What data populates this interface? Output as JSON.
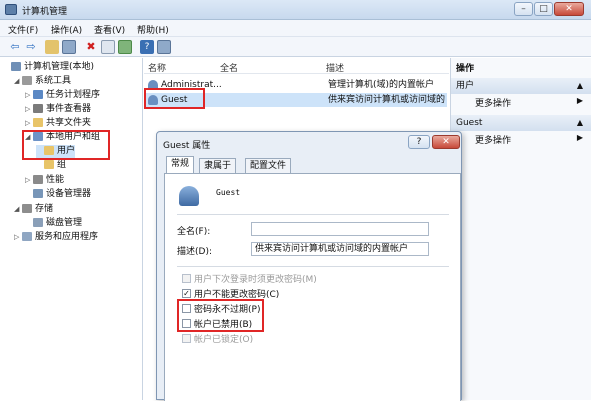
{
  "window": {
    "title": "计算机管理",
    "buttons": [
      "–",
      "□",
      "✕"
    ]
  },
  "menu": [
    "文件(F)",
    "操作(A)",
    "查看(V)",
    "帮助(H)"
  ],
  "tree": [
    {
      "label": "计算机管理(本地)",
      "icon": "computer-icon",
      "level": 0,
      "expander": ""
    },
    {
      "label": "系统工具",
      "icon": "tools-icon",
      "level": 1,
      "expander": "◢"
    },
    {
      "label": "任务计划程序",
      "icon": "clock-icon",
      "level": 2,
      "expander": "▷"
    },
    {
      "label": "事件查看器",
      "icon": "event-icon",
      "level": 2,
      "expander": "▷"
    },
    {
      "label": "共享文件夹",
      "icon": "folder-icon",
      "level": 2,
      "expander": "▷"
    },
    {
      "label": "本地用户和组",
      "icon": "users-icon",
      "level": 2,
      "expander": "◢"
    },
    {
      "label": "用户",
      "icon": "folder-icon",
      "level": 3,
      "expander": ""
    },
    {
      "label": "组",
      "icon": "folder-icon",
      "level": 3,
      "expander": ""
    },
    {
      "label": "性能",
      "icon": "performance-icon",
      "level": 2,
      "expander": "▷"
    },
    {
      "label": "设备管理器",
      "icon": "device-icon",
      "level": 2,
      "expander": ""
    },
    {
      "label": "存储",
      "icon": "storage-icon",
      "level": 1,
      "expander": "◢"
    },
    {
      "label": "磁盘管理",
      "icon": "disk-icon",
      "level": 2,
      "expander": ""
    },
    {
      "label": "服务和应用程序",
      "icon": "services-icon",
      "level": 1,
      "expander": "▷"
    }
  ],
  "list": {
    "columns": [
      "名称",
      "全名",
      "描述"
    ],
    "rows": [
      {
        "name": "Administrat...",
        "fullname": "",
        "desc": "管理计算机(域)的内置帐户"
      },
      {
        "name": "Guest",
        "fullname": "",
        "desc": "供来宾访问计算机或访问域的"
      }
    ]
  },
  "actions": {
    "header": "操作",
    "sections": [
      {
        "title": "用户",
        "item": "更多操作"
      },
      {
        "title": "Guest",
        "item": "更多操作"
      }
    ]
  },
  "dialog": {
    "title": "Guest 属性",
    "help_btn": "?",
    "close_btn": "✕",
    "tabs": [
      "常规",
      "隶属于",
      "配置文件"
    ],
    "username": "Guest",
    "fullname_label": "全名(F):",
    "fullname_value": "",
    "desc_label": "描述(D):",
    "desc_value": "供来宾访问计算机或访问域的内置帐户",
    "options": [
      {
        "label": "用户下次登录时须更改密码(M)",
        "checked": false,
        "disabled": true
      },
      {
        "label": "用户不能更改密码(C)",
        "checked": true,
        "disabled": false
      },
      {
        "label": "密码永不过期(P)",
        "checked": false,
        "disabled": false
      },
      {
        "label": "帐户已禁用(B)",
        "checked": false,
        "disabled": false
      },
      {
        "label": "帐户已锁定(O)",
        "checked": false,
        "disabled": true
      }
    ]
  },
  "colors": {
    "highlight": "#e02626",
    "selection": "#cde3f9"
  }
}
